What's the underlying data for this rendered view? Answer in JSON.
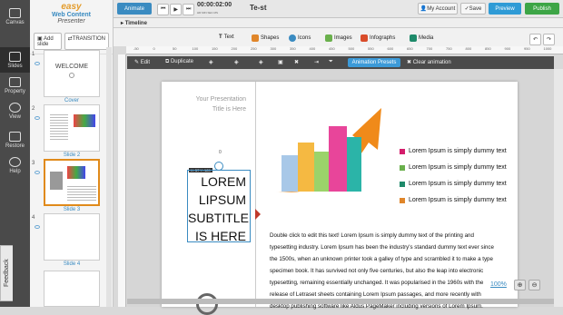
{
  "rail": {
    "items": [
      {
        "label": "Canvas"
      },
      {
        "label": "Slides"
      },
      {
        "label": "Property"
      },
      {
        "label": "View"
      },
      {
        "label": "Restore"
      },
      {
        "label": "Help"
      }
    ],
    "feedback": "Feedback"
  },
  "logo": {
    "line1": "easy",
    "line2": "Web Content",
    "line3": "Presenter"
  },
  "slides_panel": {
    "add_slide": "Add slide",
    "transition": "TRANSITION",
    "items": [
      {
        "num": "1",
        "label": "Cover",
        "thumb": "WELCOME"
      },
      {
        "num": "2",
        "label": "Slide 2"
      },
      {
        "num": "3",
        "label": "Slide 3"
      },
      {
        "num": "4",
        "label": "Slide 4"
      }
    ]
  },
  "topbar": {
    "animate": "Animate",
    "time": "00:00:02:00",
    "time_units": "HR  MIN  SEC  MS",
    "title": "Te-st",
    "account": "My Account",
    "save": "Save",
    "preview": "Preview",
    "publish": "Publish"
  },
  "timeline": {
    "label": "Timeline"
  },
  "insert": {
    "text": "Text",
    "shapes": "Shapes",
    "icons": "Icons",
    "images": "Images",
    "infographs": "Infographs",
    "media": "Media"
  },
  "edit": {
    "edit": "Edit",
    "duplicate": "Duplicate",
    "animation_presets": "Animation Presets",
    "clear_animation": "Clear animation"
  },
  "ruler": {
    "ticks": [
      "-50",
      "0",
      "50",
      "100",
      "150",
      "200",
      "250",
      "300",
      "350",
      "400",
      "450",
      "500",
      "550",
      "600",
      "650",
      "700",
      "750",
      "800",
      "850",
      "900",
      "950",
      "1000"
    ]
  },
  "page": {
    "presentation_title": "Your Presentation\nTitle is Here",
    "selection_coords": "X: 57  Y: 189",
    "big_text": [
      "LOREM",
      "LIPSUM",
      "SUBTITLE",
      "IS HERE"
    ],
    "rotation": "0",
    "bullets": [
      {
        "text": "Lorem Ipsum is simply dummy text",
        "color": "#d41d6b"
      },
      {
        "text": "Lorem Ipsum is simply dummy text",
        "color": "#6ab04c"
      },
      {
        "text": "Lorem Ipsum is simply dummy text",
        "color": "#1e8a6a"
      },
      {
        "text": "Lorem Ipsum is simply dummy text",
        "color": "#e0862a"
      }
    ],
    "body": [
      "Double click to edit this text! Lorem Ipsum is simply dummy text of the printing and",
      "typesetting industry. Lorem Ipsum has been the industry's standard dummy text ever since",
      "the 1500s, when an unknown printer took a galley of type and scrambled it to make a type",
      "specimen book. It has survived not only five centuries, but also the leap into electronic",
      "typesetting, remaining essentially unchanged. It was popularised in the 1960s with the",
      "release of Letraset sheets containing Lorem Ipsum passages, and more recently with",
      "desktop publishing software like Aldus PageMaker including versions of Lorem Ipsum."
    ]
  },
  "zoom": {
    "value": "100%"
  }
}
